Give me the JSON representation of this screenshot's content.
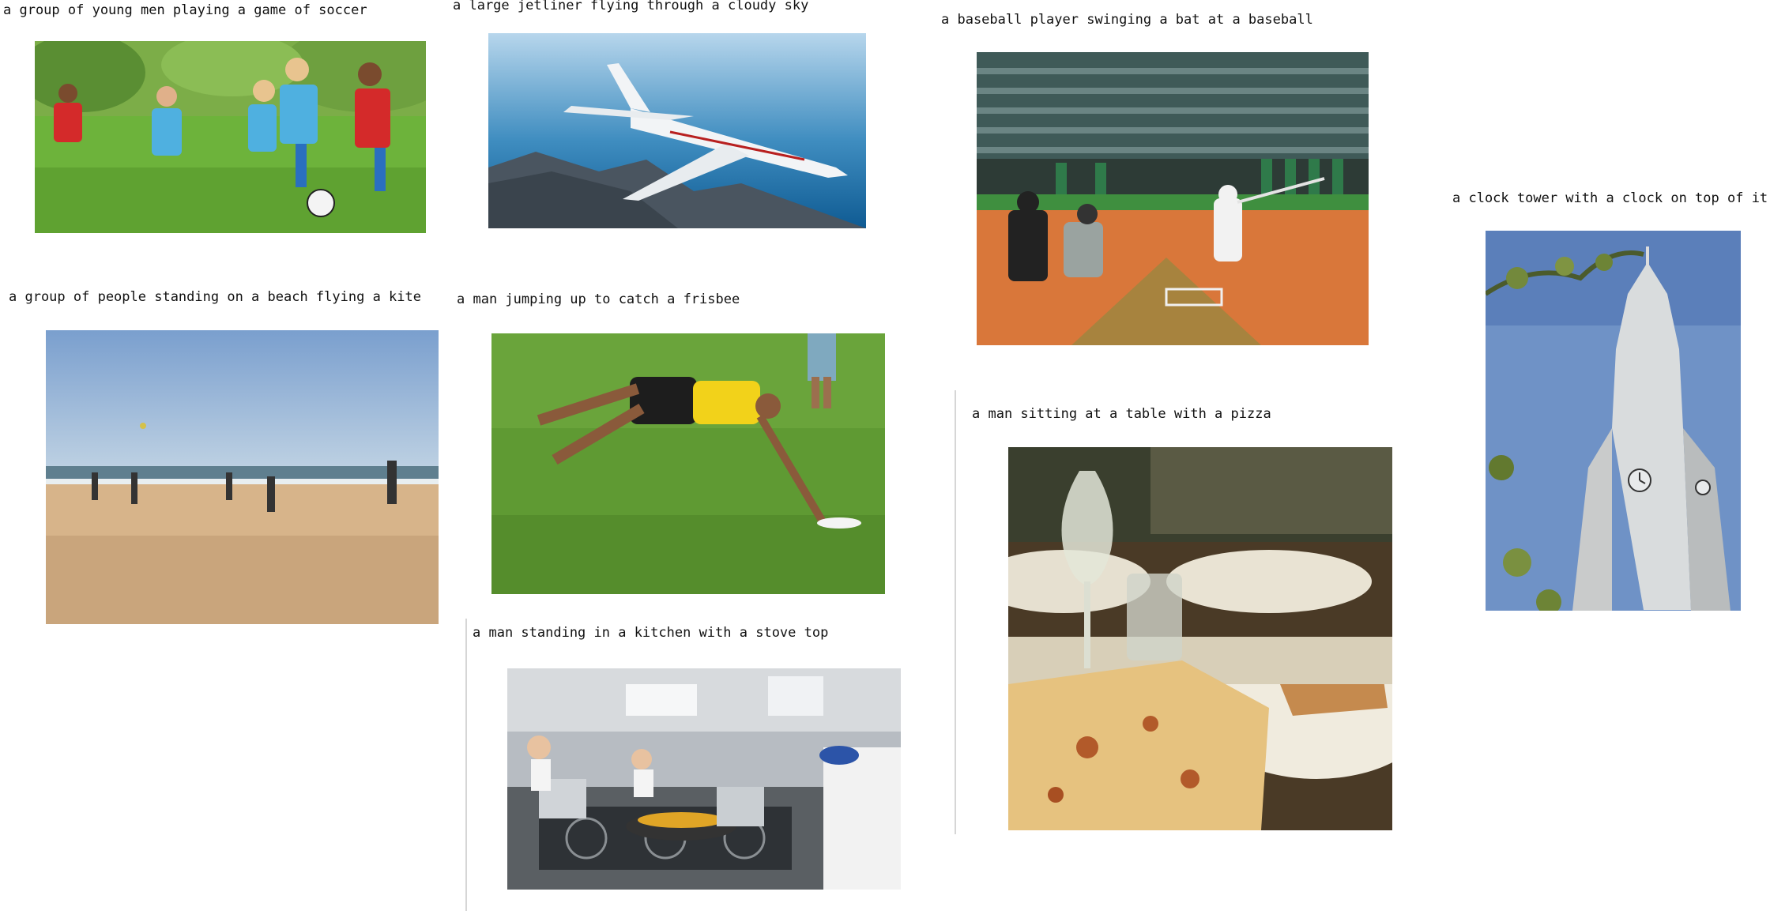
{
  "captions": {
    "soccer": "a group of young men playing a game of soccer",
    "jet": "a large jetliner flying through a cloudy sky",
    "baseball": "a baseball player swinging a bat at a baseball",
    "clock": "a clock tower with a clock on top of it",
    "kite": "a group of people standing on a beach flying a kite",
    "frisbee": "a man jumping up to catch a frisbee",
    "pizza": "a man sitting at a table with a pizza",
    "kitchen": "a man standing in a kitchen with a stove top"
  }
}
